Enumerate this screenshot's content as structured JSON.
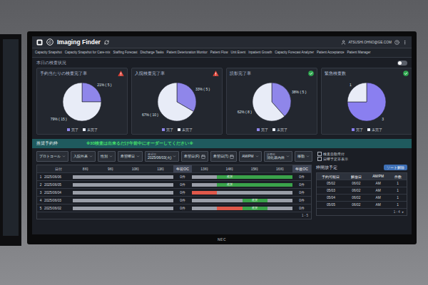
{
  "monitor": {
    "brand": "NEC"
  },
  "header": {
    "title": "Imaging Finder",
    "user": "ATSUSHI.OHNO@GE.COM"
  },
  "tabs": [
    {
      "label": "Capacity Snapshot",
      "selected": false
    },
    {
      "label": "Capacity Snapshot for Care-mix",
      "selected": false
    },
    {
      "label": "Staffing Forecast",
      "selected": false
    },
    {
      "label": "Discharge Tasks",
      "selected": false
    },
    {
      "label": "Patient Deterioration Monitor",
      "selected": false
    },
    {
      "label": "Patient Flow",
      "selected": false
    },
    {
      "label": "Unit Event",
      "selected": false
    },
    {
      "label": "Inpatient Growth",
      "selected": false
    },
    {
      "label": "Capacity Forecast Analyzer",
      "selected": false
    },
    {
      "label": "Patient Acceptance",
      "selected": false
    },
    {
      "label": "Patient Manager",
      "selected": false
    }
  ],
  "status_section": {
    "title": "本日の検査状況",
    "toggle": {
      "on": false
    },
    "cards": [
      {
        "title": "予約当たりの検査完了率",
        "status": "warning",
        "slices": [
          {
            "label": "完了",
            "value": 5,
            "text": "21% ( 5 )",
            "color": "#8f86ea"
          },
          {
            "label": "未完了",
            "value": 15,
            "text": "79% ( 15 )",
            "color": "#e8ecf7"
          }
        ]
      },
      {
        "title": "入院検査完了率",
        "status": "warning",
        "slices": [
          {
            "label": "完了",
            "value": 5,
            "text": "33% ( 5 )",
            "color": "#8f86ea"
          },
          {
            "label": "未完了",
            "value": 10,
            "text": "67% ( 10 )",
            "color": "#e8ecf7"
          }
        ]
      },
      {
        "title": "読影完了率",
        "status": "ok",
        "slices": [
          {
            "label": "完了",
            "value": 5,
            "text": "38% ( 5 )",
            "color": "#8f86ea"
          },
          {
            "label": "未完了",
            "value": 8,
            "text": "62% ( 8 )",
            "color": "#e8ecf7"
          }
        ]
      },
      {
        "title": "緊急検査数",
        "status": "ok",
        "slices": [
          {
            "label": "完了",
            "value": 3,
            "text": "3",
            "color": "#8a7ff0"
          },
          {
            "label": "未完了",
            "value": 1,
            "text": "1",
            "color": "#e8ecf7"
          }
        ]
      }
    ]
  },
  "booking": {
    "title": "推奨予約枠",
    "notice": "※3D検査は出来るだけ午前中にオーダーしてください※",
    "filters": [
      {
        "kind": "select",
        "value": "プロトコール"
      },
      {
        "kind": "select",
        "value": "入院外来"
      },
      {
        "kind": "select",
        "value": "性別"
      },
      {
        "kind": "select",
        "value": "希望曜日"
      },
      {
        "kind": "select",
        "caption": "希望日",
        "value": "2025/06/03(火)"
      },
      {
        "kind": "date",
        "value": "希望日(F)"
      },
      {
        "kind": "date",
        "value": "希望日(T)"
      },
      {
        "kind": "select",
        "value": "AM/PM"
      },
      {
        "kind": "select",
        "caption": "診療科",
        "value": "消化器内科"
      },
      {
        "kind": "select",
        "value": "移動"
      }
    ],
    "checkboxes": [
      {
        "label": "検査自動受付",
        "checked": false
      },
      {
        "label": "日曜予定非表示",
        "checked": false
      }
    ],
    "table": {
      "columns": [
        "日付",
        "8時",
        "9時",
        "10時",
        "11時",
        "午前OC",
        "13時",
        "14時",
        "15時",
        "16時",
        "午後OC"
      ],
      "rows": [
        {
          "index": "1",
          "date": "2025/06/06",
          "am": [
            {
              "kind": "free"
            },
            {
              "kind": "free"
            },
            {
              "kind": "free"
            },
            {
              "kind": "free"
            }
          ],
          "am_count": "0件",
          "pm": [
            {
              "kind": "free"
            },
            {
              "kind": "recommended",
              "label": "推奨"
            },
            {
              "kind": "recommended"
            },
            {
              "kind": "recommended"
            }
          ],
          "pm_count": "0件"
        },
        {
          "index": "2",
          "date": "2025/06/05",
          "am": [
            {
              "kind": "free"
            },
            {
              "kind": "free"
            },
            {
              "kind": "free"
            },
            {
              "kind": "free"
            }
          ],
          "am_count": "0件",
          "pm": [
            {
              "kind": "free"
            },
            {
              "kind": "recommended",
              "label": "推奨"
            },
            {
              "kind": "recommended"
            },
            {
              "kind": "recommended"
            }
          ],
          "pm_count": "0件"
        },
        {
          "index": "3",
          "date": "2025/06/04",
          "am": [
            {
              "kind": "free"
            },
            {
              "kind": "free"
            },
            {
              "kind": "free"
            },
            {
              "kind": "free"
            }
          ],
          "am_count": "0件",
          "pm": [
            {
              "kind": "booked"
            },
            {
              "kind": "free"
            },
            {
              "kind": "free"
            },
            {
              "kind": "free"
            }
          ],
          "pm_count": "0件"
        },
        {
          "index": "4",
          "date": "2025/06/03",
          "am": [
            {
              "kind": "free"
            },
            {
              "kind": "free"
            },
            {
              "kind": "free"
            },
            {
              "kind": "free"
            }
          ],
          "am_count": "0件",
          "pm": [
            {
              "kind": "free"
            },
            {
              "kind": "free"
            },
            {
              "kind": "recommended",
              "label": "推奨"
            },
            {
              "kind": "free"
            }
          ],
          "pm_count": "0件"
        },
        {
          "index": "5",
          "date": "2025/06/02",
          "am": [
            {
              "kind": "free"
            },
            {
              "kind": "free"
            },
            {
              "kind": "free"
            },
            {
              "kind": "free"
            }
          ],
          "am_count": "0件",
          "pm": [
            {
              "kind": "free"
            },
            {
              "kind": "booked"
            },
            {
              "kind": "recommended",
              "label": "推奨"
            },
            {
              "kind": "free"
            }
          ],
          "pm_count": "0件"
        }
      ],
      "pagination": "1 - 5"
    }
  },
  "release": {
    "title": "枠開放予定",
    "button": "ソート解除",
    "columns": [
      "予約可能日",
      "解放日",
      "AM/PM",
      "件数"
    ],
    "rows": [
      [
        "05/02",
        "06/02",
        "AM",
        "1"
      ],
      [
        "05/03",
        "06/02",
        "AM",
        "1"
      ],
      [
        "05/04",
        "06/02",
        "AM",
        "1"
      ],
      [
        "05/05",
        "06/02",
        "AM",
        "1"
      ]
    ],
    "pagination": "1 - 4",
    "next": "▸"
  }
}
